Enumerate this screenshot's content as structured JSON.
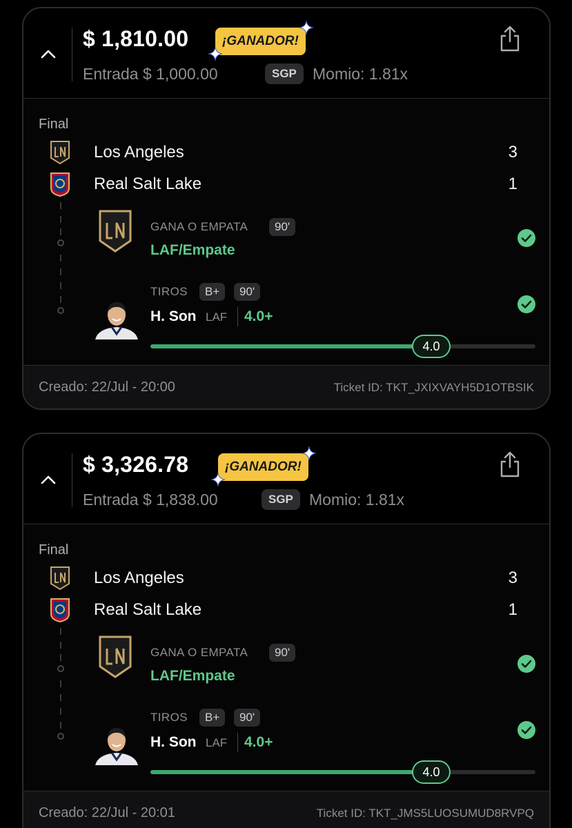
{
  "tickets": [
    {
      "amount": "$ 1,810.00",
      "status_badge": "¡GANADOR!",
      "entry": "Entrada $ 1,000.00",
      "tag": "SGP",
      "momio": "Momio: 1.81x",
      "result_label": "Final",
      "teams": [
        {
          "name": "Los Angeles",
          "score": "3",
          "logo": "lafc-crest-icon"
        },
        {
          "name": "Real Salt Lake",
          "score": "1",
          "logo": "rsl-crest-icon"
        }
      ],
      "picks": [
        {
          "market": "GANA O EMPATA",
          "pills": [
            "90'"
          ],
          "selection": "LAF/Empate",
          "won": true
        },
        {
          "market": "TIROS",
          "pills": [
            "B+",
            "90'"
          ],
          "player": "H. Son",
          "team": "LAF",
          "line": "4.0+",
          "progress_value": "4.0",
          "progress_fraction": 0.73,
          "won": true
        }
      ],
      "created": "Creado: 22/Jul - 20:00",
      "ticket_id": "Ticket ID: TKT_JXIXVAYH5D1OTBSIK"
    },
    {
      "amount": "$ 3,326.78",
      "status_badge": "¡GANADOR!",
      "entry": "Entrada $ 1,838.00",
      "tag": "SGP",
      "momio": "Momio: 1.81x",
      "result_label": "Final",
      "teams": [
        {
          "name": "Los Angeles",
          "score": "3",
          "logo": "lafc-crest-icon"
        },
        {
          "name": "Real Salt Lake",
          "score": "1",
          "logo": "rsl-crest-icon"
        }
      ],
      "picks": [
        {
          "market": "GANA O EMPATA",
          "pills": [
            "90'"
          ],
          "selection": "LAF/Empate",
          "won": true
        },
        {
          "market": "TIROS",
          "pills": [
            "B+",
            "90'"
          ],
          "player": "H. Son",
          "team": "LAF",
          "line": "4.0+",
          "progress_value": "4.0",
          "progress_fraction": 0.73,
          "won": true
        }
      ],
      "created": "Creado: 22/Jul - 20:01",
      "ticket_id": "Ticket ID: TKT_JMS5LUOSUMUD8RVPQ"
    }
  ],
  "colors": {
    "badge_bg": "#f5c542",
    "win_green": "#5ec98a",
    "progress_green": "#3ea86f",
    "card_border": "#2c2c2e"
  }
}
